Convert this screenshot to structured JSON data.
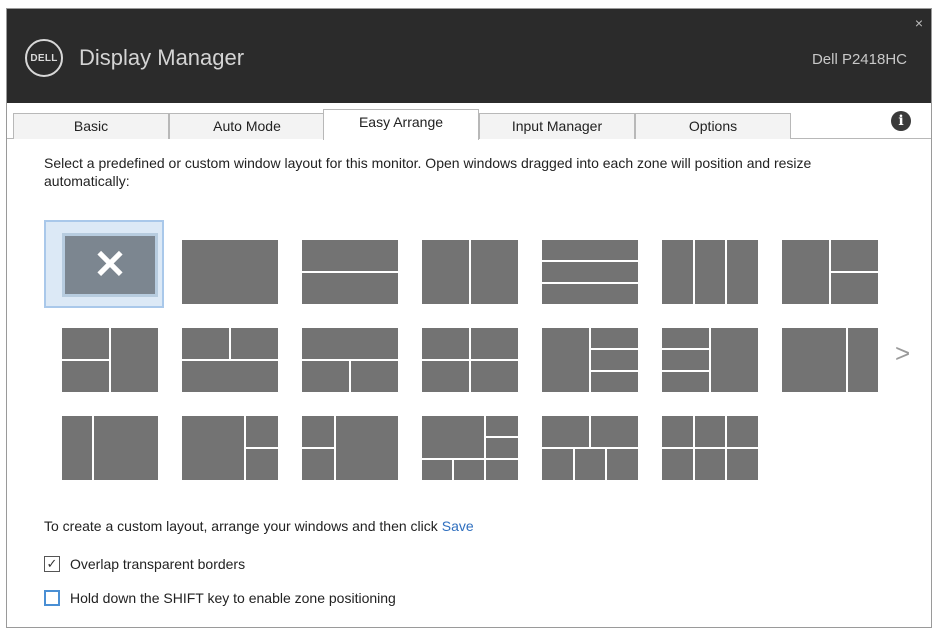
{
  "header": {
    "logo_text": "DELL",
    "title": "Display Manager",
    "model": "Dell P2418HC",
    "close_glyph": "×"
  },
  "tabs": [
    {
      "label": "Basic"
    },
    {
      "label": "Auto Mode"
    },
    {
      "label": "Easy Arrange",
      "active": true
    },
    {
      "label": "Input Manager"
    },
    {
      "label": "Options"
    }
  ],
  "info_glyph": "i",
  "instructions": "Select a predefined or custom window layout for this monitor.  Open windows dragged into each zone will position and resize automatically:",
  "layouts": {
    "selected_glyph": "✕",
    "next_glyph": ">",
    "count_visible": 20
  },
  "custom": {
    "text": "To create a custom layout, arrange your windows and then click",
    "link": "Save"
  },
  "options": {
    "overlap": {
      "label": "Overlap transparent borders",
      "checked": true,
      "check_glyph": "✓"
    },
    "shift": {
      "label": "Hold down the SHIFT key to enable zone positioning",
      "checked": false
    }
  },
  "colors": {
    "header_bg": "#2b2b2b",
    "zone": "#737373",
    "selected_frame": "#a9c8ea",
    "link": "#2f6fbf"
  }
}
